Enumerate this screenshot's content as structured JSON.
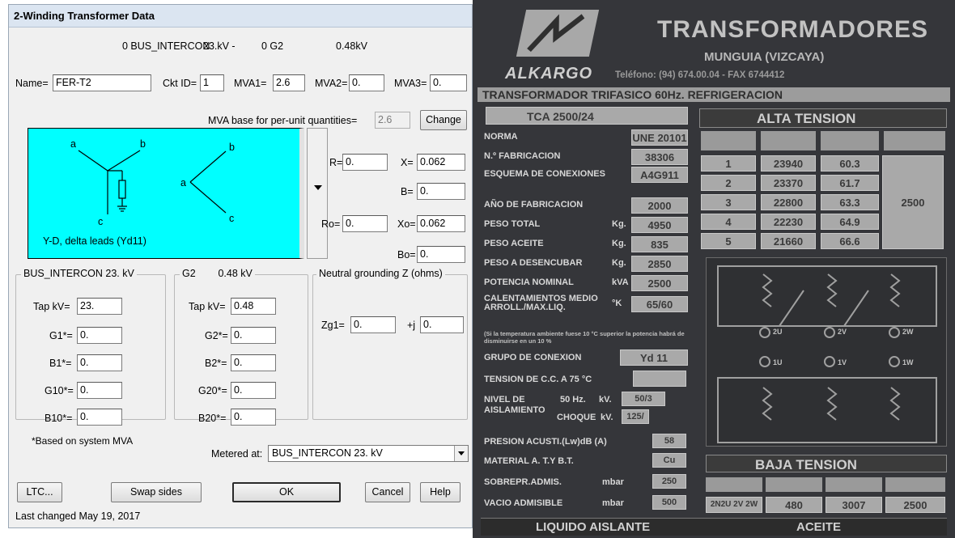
{
  "dialog": {
    "title": "2-Winding Transformer Data",
    "header": {
      "from_bus": "0 BUS_INTERCON",
      "from_kv": "23.kV -",
      "to_bus": "0 G2",
      "to_kv": "0.48kV"
    },
    "name_label": "Name=",
    "name_value": "FER-T2",
    "ckt_label": "Ckt ID=",
    "ckt_value": "1",
    "mva1_label": "MVA1=",
    "mva1_value": "2.6",
    "mva2_label": "MVA2=",
    "mva2_value": "0.",
    "mva3_label": "MVA3=",
    "mva3_value": "0.",
    "mva_base_label": "MVA base for per-unit quantities=",
    "mva_base_value": "2.6",
    "change_button": "Change",
    "diagram": {
      "caption": "Y-D, delta leads (Yd11)",
      "labels": {
        "a1": "a",
        "b1": "b",
        "c1": "c",
        "a2": "a",
        "b2": "b",
        "c2": "c"
      }
    },
    "impedance": {
      "r_label": "R=",
      "r_value": "0.",
      "x_label": "X=",
      "x_value": "0.062",
      "b_label": "B=",
      "b_value": "0.",
      "ro_label": "Ro=",
      "ro_value": "0.",
      "xo_label": "Xo=",
      "xo_value": "0.062",
      "bo_label": "Bo=",
      "bo_value": "0."
    },
    "bus1_group": {
      "legend": "BUS_INTERCON 23.  kV",
      "tap_label": "Tap kV=",
      "tap_value": "23.",
      "g1_label": "G1*=",
      "g1_value": "0.",
      "b1_label": "B1*=",
      "b1_value": "0.",
      "g10_label": "G10*=",
      "g10_value": "0.",
      "b10_label": "B10*=",
      "b10_value": "0."
    },
    "bus2_group": {
      "legend": "G2        0.48 kV",
      "tap_label": "Tap kV=",
      "tap_value": "0.48",
      "g2_label": "G2*=",
      "g2_value": "0.",
      "b2_label": "B2*=",
      "b2_value": "0.",
      "g20_label": "G20*=",
      "g20_value": "0.",
      "b20_label": "B20*=",
      "b20_value": "0."
    },
    "neutral_group": {
      "legend": "Neutral grounding Z (ohms)",
      "zg1_label": "Zg1=",
      "zg1_value": "0.",
      "j_label": "+j",
      "j_value": "0."
    },
    "footnote": "*Based on system MVA",
    "metered_label": "Metered at:",
    "metered_value": "BUS_INTERCON 23.  kV",
    "ltc_button": "LTC...",
    "swap_button": "Swap sides",
    "ok_button": "OK",
    "cancel_button": "Cancel",
    "help_button": "Help",
    "last_changed": "Last changed May 19, 2017"
  },
  "nameplate": {
    "brand": "TRANSFORMADORES",
    "location": "MUNGUIA (VIZCAYA)",
    "logo_text": "ALKARGO",
    "phone": "Teléfono: (94) 674.00.04 - FAX 6744412",
    "subtitle": "TRANSFORMADOR TRIFASICO 60Hz. REFRIGERACION",
    "model": "TCA 2500/24",
    "rows": [
      {
        "label": "NORMA",
        "unit": "",
        "value": "UNE 20101"
      },
      {
        "label": "N.º FABRICACION",
        "unit": "",
        "value": "38306"
      },
      {
        "label": "ESQUEMA DE CONEXIONES",
        "unit": "",
        "value": "A4G911"
      },
      {
        "label": "AÑO DE FABRICACION",
        "unit": "",
        "value": "2000"
      },
      {
        "label": "PESO TOTAL",
        "unit": "Kg.",
        "value": "4950"
      },
      {
        "label": "PESO ACEITE",
        "unit": "Kg.",
        "value": "835"
      },
      {
        "label": "PESO A DESENCUBAR",
        "unit": "Kg.",
        "value": "2850"
      },
      {
        "label": "POTENCIA NOMINAL",
        "unit": "kVA",
        "value": "2500"
      },
      {
        "label": "CALENTAMIENTOS MEDIO ARROLL./MAX.LIQ.",
        "unit": "°K",
        "value": "65/60"
      }
    ],
    "fine_print": "(Si la temperatura ambiente fuese 10 °C superior la potencia habrá de disminuirse en un 10 %",
    "grupo_label": "GRUPO DE CONEXION",
    "grupo_value": "Yd 11",
    "tension_cc_label": "TENSION DE C.C. A 75 °C",
    "nivel_label": "NIVEL DE AISLAMIENTO",
    "nivel_hz_label": "50 Hz.",
    "nivel_hz_unit": "kV.",
    "nivel_hz_value": "50/3",
    "nivel_choque_label": "CHOQUE",
    "nivel_choque_unit": "kV.",
    "nivel_choque_value": "125/",
    "presion_label": "PRESION ACUSTI.(Lw)dB (A)",
    "presion_value": "58",
    "material_label": "MATERIAL A. T.Y B.T.",
    "material_value": "Cu",
    "sobrepr_label": "SOBREPR.ADMIS.",
    "sobrepr_unit": "mbar",
    "sobrepr_value": "250",
    "vacio_label": "VACIO ADMISIBLE",
    "vacio_unit": "mbar",
    "vacio_value": "500",
    "liquido_label": "LIQUIDO AISLANTE",
    "aceite_label": "ACEITE",
    "alta_tension": {
      "title": "ALTA TENSION",
      "rows": [
        {
          "pos": "1",
          "tension": "23940",
          "intensidad": "60.3"
        },
        {
          "pos": "2",
          "tension": "23370",
          "intensidad": "61.7"
        },
        {
          "pos": "3",
          "tension": "22800",
          "intensidad": "63.3"
        },
        {
          "pos": "4",
          "tension": "22230",
          "intensidad": "64.9"
        },
        {
          "pos": "5",
          "tension": "21660",
          "intensidad": "66.6"
        }
      ],
      "potencia": "2500"
    },
    "terminals_hv": [
      "2U",
      "2V",
      "2W"
    ],
    "terminals_lv": [
      "1U",
      "1V",
      "1W"
    ],
    "baja_tension": {
      "title": "BAJA TENSION",
      "linea": "2N2U 2V 2W",
      "tension": "480",
      "intensidad": "3007",
      "potencia": "2500"
    }
  }
}
